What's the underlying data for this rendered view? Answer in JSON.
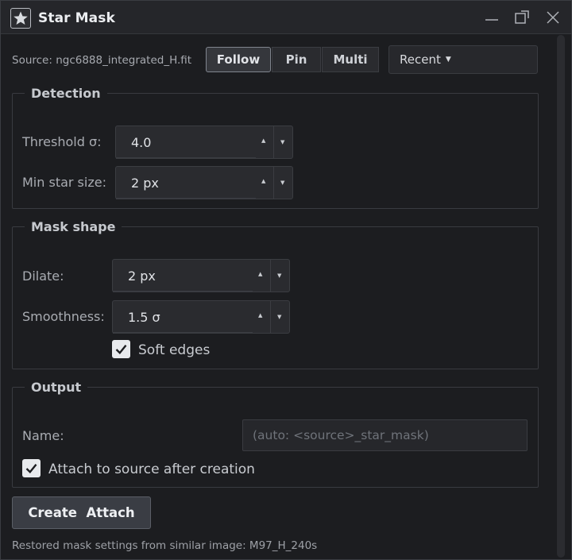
{
  "window": {
    "title": "Star Mask",
    "app_icon": "star-icon"
  },
  "source": {
    "label": "Source: ngc6888_integrated_H.fit",
    "modes": [
      {
        "label": "Follow",
        "selected": true
      },
      {
        "label": "Pin",
        "selected": false
      },
      {
        "label": "Multi",
        "selected": false
      }
    ],
    "recent_label": "Recent"
  },
  "detection": {
    "title": "Detection",
    "threshold_label": "Threshold σ:",
    "threshold_value": "4.0",
    "min_size_label": "Min star size:",
    "min_size_value": "2 px"
  },
  "mask_shape": {
    "title": "Mask shape",
    "dilate_label": "Dilate:",
    "dilate_value": "2 px",
    "smoothness_label": "Smoothness:",
    "smoothness_value": "1.5 σ",
    "soft_edges_label": "Soft edges",
    "soft_edges_checked": true
  },
  "output": {
    "title": "Output",
    "name_label": "Name:",
    "name_placeholder": "(auto: <source>_star_mask)",
    "attach_label": "Attach to source after creation",
    "attach_checked": true
  },
  "actions": {
    "create_label": "Create  Attach"
  },
  "status": {
    "text": "Restored mask settings from similar image: M97_H_240s"
  }
}
